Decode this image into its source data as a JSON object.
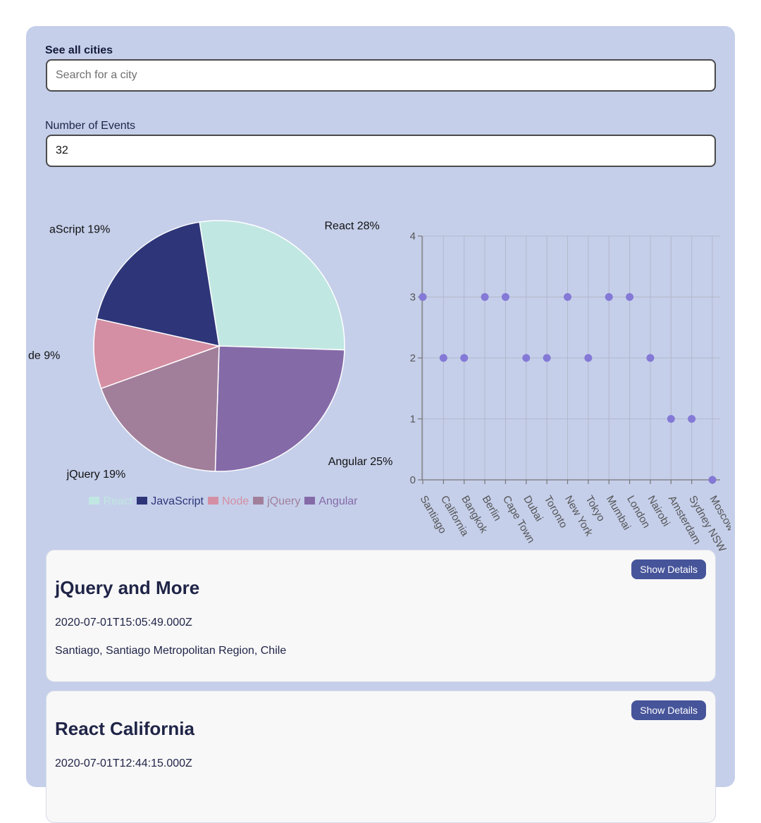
{
  "search": {
    "label": "See all cities",
    "placeholder": "Search for a city",
    "value": ""
  },
  "number_of_events": {
    "label": "Number of Events",
    "value": "32"
  },
  "chart_data": [
    {
      "type": "pie",
      "slices": [
        {
          "label": "React",
          "value": 28,
          "color": "#c1e7e2"
        },
        {
          "label": "Angular",
          "value": 25,
          "color": "#856aa8"
        },
        {
          "label": "jQuery",
          "value": 19,
          "color": "#a17f9b"
        },
        {
          "label": "Node",
          "value": 9,
          "color": "#d48fa4"
        },
        {
          "label": "JavaScript",
          "value": 19,
          "color": "#2e3679"
        }
      ],
      "slice_labels": [
        "React 28%",
        "Angular 25%",
        "jQuery 19%",
        "de 9%",
        "aScript 19%"
      ],
      "legend": {
        "placement": "bottom",
        "items": [
          {
            "label": "React",
            "color": "#c1e7e2"
          },
          {
            "label": "JavaScript",
            "color": "#2e3679"
          },
          {
            "label": "Node",
            "color": "#d48fa4"
          },
          {
            "label": "jQuery",
            "color": "#a17f9b"
          },
          {
            "label": "Angular",
            "color": "#856aa8"
          }
        ]
      }
    },
    {
      "type": "scatter",
      "categories": [
        "Santiago",
        "California",
        "Bangkok",
        "Berlin",
        "Cape Town",
        "Dubai",
        "Toronto",
        "New York",
        "Tokyo",
        "Mumbai",
        "London",
        "Nairobi",
        "Amsterdam",
        "Sydney NSW",
        "Moscow"
      ],
      "values": [
        3,
        2,
        2,
        3,
        3,
        2,
        2,
        3,
        2,
        3,
        3,
        2,
        1,
        1,
        0
      ],
      "ylim": [
        0,
        4
      ],
      "yticks": [
        "0",
        "1",
        "2",
        "3",
        "4"
      ],
      "grid": true,
      "point_color": "#8479d6"
    }
  ],
  "events": [
    {
      "title": "jQuery and More",
      "date": "2020-07-01T15:05:49.000Z",
      "location": "Santiago, Santiago Metropolitan Region, Chile",
      "button_label": "Show Details"
    },
    {
      "title": "React California",
      "date": "2020-07-01T12:44:15.000Z",
      "location": "",
      "button_label": "Show Details"
    }
  ]
}
